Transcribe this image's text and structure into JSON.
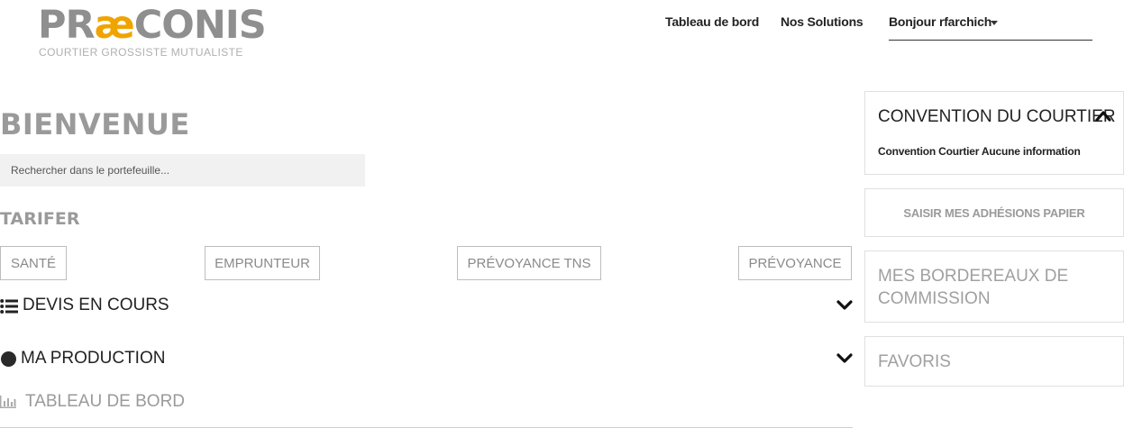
{
  "logo": {
    "pr": "PR",
    "ae": "æ",
    "rest": "CONIS",
    "tagline": "COURTIER GROSSISTE MUTUALISTE"
  },
  "nav": {
    "dashboard": "Tableau de bord",
    "solutions": "Nos Solutions",
    "user": "Bonjour rfarchich"
  },
  "main": {
    "title": "BIENVENUE",
    "search_placeholder": "Rechercher dans le portefeuille...",
    "tarifer": "TARIFER",
    "tarif_buttons": [
      "SANTÉ",
      "EMPRUNTEUR",
      "PRÉVOYANCE TNS",
      "PRÉVOYANCE"
    ],
    "sections": {
      "devis": "DEVIS EN COURS",
      "production": "MA PRODUCTION",
      "tableau": "TABLEAU DE BORD"
    }
  },
  "sidebar": {
    "convention_title": "CONVENTION DU COURTIER",
    "convention_text": "Convention Courtier Aucune information",
    "saisir": "SAISIR MES ADHÉSIONS PAPIER",
    "bordereaux": "MES BORDEREAUX DE COMMISSION",
    "favoris": "FAVORIS"
  },
  "colors": {
    "logo_accent": "#f0a400",
    "muted_text": "#9a9a9a",
    "dark_text": "#222222"
  }
}
